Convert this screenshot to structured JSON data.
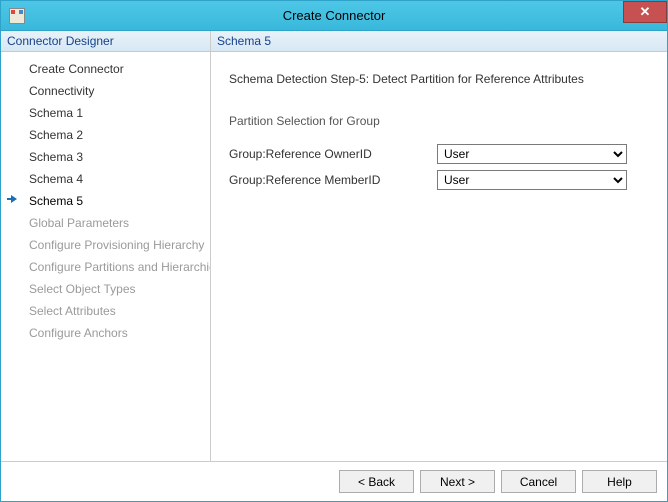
{
  "window": {
    "title": "Create Connector"
  },
  "sidebar": {
    "header": "Connector Designer",
    "items": [
      {
        "label": "Create Connector",
        "state": "past"
      },
      {
        "label": "Connectivity",
        "state": "past"
      },
      {
        "label": "Schema 1",
        "state": "past"
      },
      {
        "label": "Schema 2",
        "state": "past"
      },
      {
        "label": "Schema 3",
        "state": "past"
      },
      {
        "label": "Schema 4",
        "state": "past"
      },
      {
        "label": "Schema 5",
        "state": "current"
      },
      {
        "label": "Global Parameters",
        "state": "future"
      },
      {
        "label": "Configure Provisioning Hierarchy",
        "state": "future"
      },
      {
        "label": "Configure Partitions and Hierarchies",
        "state": "future"
      },
      {
        "label": "Select Object Types",
        "state": "future"
      },
      {
        "label": "Select Attributes",
        "state": "future"
      },
      {
        "label": "Configure Anchors",
        "state": "future"
      }
    ]
  },
  "main": {
    "header": "Schema 5",
    "step_description": "Schema Detection Step-5: Detect Partition for Reference Attributes",
    "section_title": "Partition Selection for Group",
    "rows": [
      {
        "label": "Group:Reference OwnerID",
        "value": "User"
      },
      {
        "label": "Group:Reference MemberID",
        "value": "User"
      }
    ]
  },
  "footer": {
    "back": "<  Back",
    "next": "Next  >",
    "cancel": "Cancel",
    "help": "Help"
  }
}
